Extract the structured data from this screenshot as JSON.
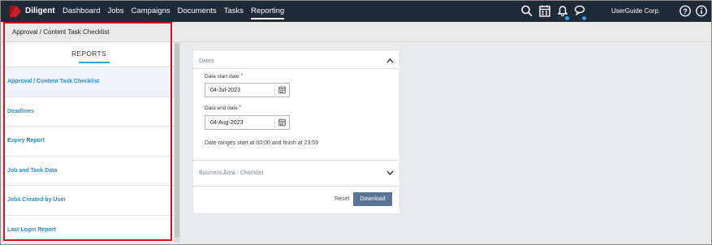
{
  "app": {
    "brand": "Diligent",
    "company": "UserGuide Corp."
  },
  "nav": {
    "items": [
      {
        "label": "Dashboard"
      },
      {
        "label": "Jobs"
      },
      {
        "label": "Campaigns"
      },
      {
        "label": "Documents"
      },
      {
        "label": "Tasks"
      },
      {
        "label": "Reporting",
        "active": true
      }
    ]
  },
  "toolbar_icons": [
    "search-icon",
    "calendar-icon",
    "bell-icon",
    "chat-icon",
    "help-icon",
    "info-icon"
  ],
  "page": {
    "title": "Approval / Content Task Checklist"
  },
  "sidebar": {
    "tab_label": "REPORTS",
    "items": [
      {
        "label": "Approval / Content Task Checklist",
        "selected": true
      },
      {
        "label": "Deadlines"
      },
      {
        "label": "Expiry Report"
      },
      {
        "label": "Job and Task Data"
      },
      {
        "label": "Jobs Created by User"
      },
      {
        "label": "Last Login Report"
      }
    ]
  },
  "form": {
    "dates_section": "Dates",
    "start_label": "Data start date",
    "start_value": "04-Jul-2023",
    "end_label": "Data end date",
    "end_value": "04-Aug-2023",
    "required_mark": "*",
    "note": "Date ranges start at 00:00 and finish at 23:59",
    "business_section": "Business Area - Checklist",
    "reset_label": "Reset",
    "download_label": "Download"
  },
  "colors": {
    "topbar": "#1f2a39",
    "link": "#2d8bc9",
    "accent": "#3aa0d6",
    "highlight": "#d0141e",
    "button": "#5a7496"
  }
}
